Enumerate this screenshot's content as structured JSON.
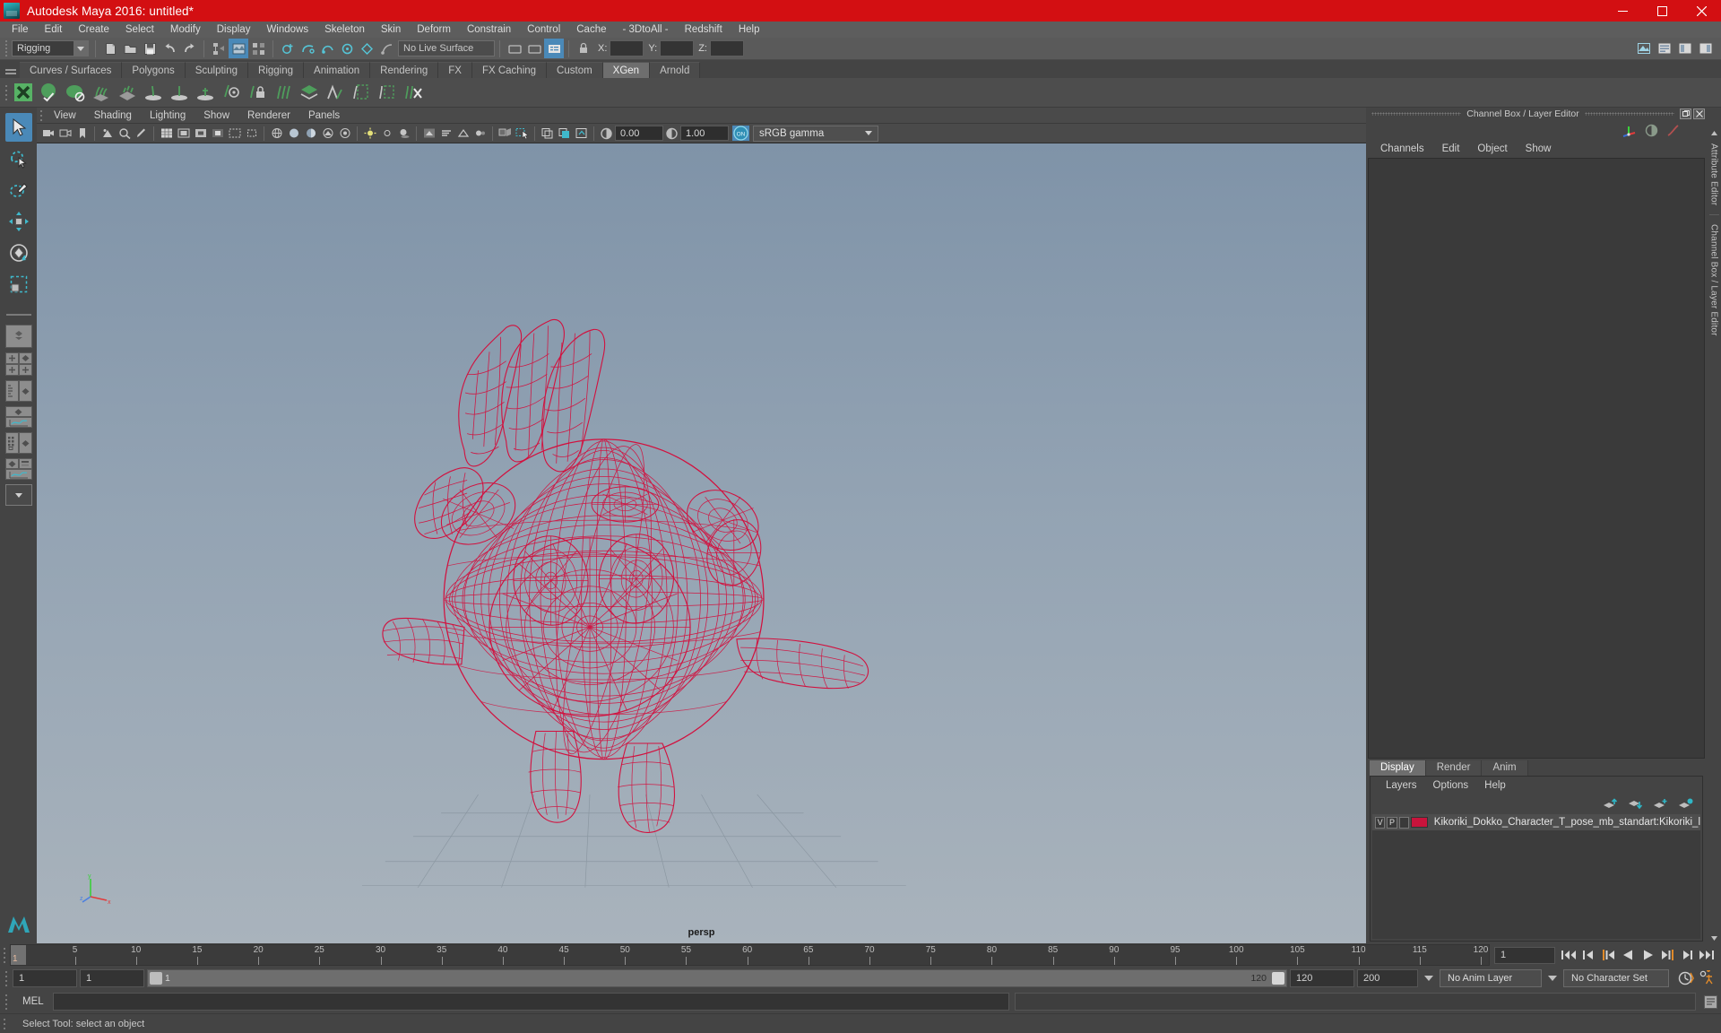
{
  "window": {
    "title": "Autodesk Maya 2016: untitled*",
    "logo_icon": "maya-logo-icon",
    "minimize_icon": "minimize-icon",
    "maximize_icon": "maximize-icon",
    "close_icon": "close-icon",
    "titlebar_color": "#d30f12"
  },
  "menubar": {
    "items": [
      {
        "label": "File"
      },
      {
        "label": "Edit"
      },
      {
        "label": "Create"
      },
      {
        "label": "Select"
      },
      {
        "label": "Modify"
      },
      {
        "label": "Display"
      },
      {
        "label": "Windows"
      },
      {
        "label": "Skeleton"
      },
      {
        "label": "Skin"
      },
      {
        "label": "Deform"
      },
      {
        "label": "Constrain"
      },
      {
        "label": "Control"
      },
      {
        "label": "Cache"
      },
      {
        "label": "- 3DtoAll -"
      },
      {
        "label": "Redshift"
      },
      {
        "label": "Help"
      }
    ]
  },
  "statusline": {
    "selection_mode": "Rigging",
    "live_surface": "No Live Surface",
    "coord_x_label": "X:",
    "coord_y_label": "Y:",
    "coord_z_label": "Z:",
    "coord_x_value": "",
    "coord_y_value": "",
    "coord_z_value": ""
  },
  "shelf": {
    "tabs": [
      {
        "label": "Curves / Surfaces",
        "active": false
      },
      {
        "label": "Polygons",
        "active": false
      },
      {
        "label": "Sculpting",
        "active": false
      },
      {
        "label": "Rigging",
        "active": false
      },
      {
        "label": "Animation",
        "active": false
      },
      {
        "label": "Rendering",
        "active": false
      },
      {
        "label": "FX",
        "active": false
      },
      {
        "label": "FX Caching",
        "active": false
      },
      {
        "label": "Custom",
        "active": false
      },
      {
        "label": "XGen",
        "active": true
      },
      {
        "label": "Arnold",
        "active": false
      }
    ],
    "icon_names": [
      "xgen-description-icon",
      "xgen-sphere-icon",
      "xgen-dome-icon",
      "xgen-grass-icon",
      "xgen-scatter-icon",
      "xgen-curve-add-icon",
      "xgen-cross-icon",
      "xgen-eye-icon",
      "xgen-lock-icon",
      "xgen-comb-icon",
      "xgen-layer-icon",
      "xgen-guide-icon",
      "xgen-region-icon",
      "xgen-select-region-icon",
      "xgen-delete-icon"
    ]
  },
  "toolbox": {
    "tools": [
      {
        "name": "select-tool",
        "selected": true
      },
      {
        "name": "lasso-select-tool",
        "selected": false
      },
      {
        "name": "paint-select-tool",
        "selected": false
      },
      {
        "name": "move-tool",
        "selected": false
      },
      {
        "name": "rotate-tool",
        "selected": false
      },
      {
        "name": "scale-tool",
        "selected": false
      }
    ],
    "layout_presets": [
      "single-perspective-layout",
      "two-pane-layout",
      "outliner-persp-layout",
      "persp-graph-layout",
      "hypershade-layout",
      "persp-outliner-graph-layout",
      "more-layouts"
    ]
  },
  "viewport": {
    "panel_menu": [
      "View",
      "Shading",
      "Lighting",
      "Show",
      "Renderer",
      "Panels"
    ],
    "camera_label": "persp",
    "exposure_value": "0.00",
    "gamma_value": "1.00",
    "color_management": "sRGB gamma",
    "color_management_toggle": "ON",
    "gizmo_axes": [
      "x",
      "y",
      "z"
    ],
    "wireframe_color": "#d2103e",
    "background_top": "#7f93a8",
    "background_bottom": "#a9b3bc",
    "model_description": "Kikoriki Dokko reindeer character wireframe mesh"
  },
  "right_dock": {
    "panel_title": "Channel Box / Layer Editor",
    "undock_icon": "undock-icon",
    "close_icon": "close-panel-icon",
    "channel_menu": [
      "Channels",
      "Edit",
      "Object",
      "Show"
    ],
    "header_icons": [
      "transform-axis-icon",
      "half-circle-icon",
      "anim-curve-icon"
    ],
    "layer_tabs": [
      {
        "label": "Display",
        "active": true
      },
      {
        "label": "Render",
        "active": false
      },
      {
        "label": "Anim",
        "active": false
      }
    ],
    "layer_menu": [
      "Layers",
      "Options",
      "Help"
    ],
    "layer_buttons": [
      "move-layer-up-icon",
      "move-layer-down-icon",
      "new-layer-icon",
      "new-layer-from-selected-icon"
    ],
    "layers": [
      {
        "visibility": "V",
        "playback": "P",
        "shading": "",
        "color": "#c8143c",
        "name": "Kikoriki_Dokko_Character_T_pose_mb_standart:Kikoriki_l",
        "selected": true
      }
    ],
    "vertical_tabs": [
      "Attribute Editor",
      "Channel Box / Layer Editor"
    ]
  },
  "timeline": {
    "start_frame": "1",
    "end_frame": "120",
    "current_frame": "1",
    "ticks": [
      5,
      10,
      15,
      20,
      25,
      30,
      35,
      40,
      45,
      50,
      55,
      60,
      65,
      70,
      75,
      80,
      85,
      90,
      95,
      100,
      105,
      110,
      115,
      120
    ],
    "range_start": "1",
    "range_end": "120",
    "playback_start": "1",
    "playback_end": "120",
    "anim_end": "200",
    "range_slider_left_value": "1",
    "range_slider_right_value": "120",
    "anim_layer": "No Anim Layer",
    "character_set": "No Character Set",
    "playback_buttons": [
      "go-to-start-icon",
      "step-back-frame-icon",
      "step-back-key-icon",
      "play-backwards-icon",
      "play-forwards-icon",
      "step-forward-key-icon",
      "step-forward-frame-icon",
      "go-to-end-icon"
    ],
    "auto_key_icon": "auto-keyframe-icon",
    "anim_prefs_icon": "animation-preferences-icon"
  },
  "command_line": {
    "language_label": "MEL",
    "input_value": "",
    "output_value": "",
    "script_editor_icon": "script-editor-icon"
  },
  "status_bar": {
    "help_text": "Select Tool: select an object"
  }
}
